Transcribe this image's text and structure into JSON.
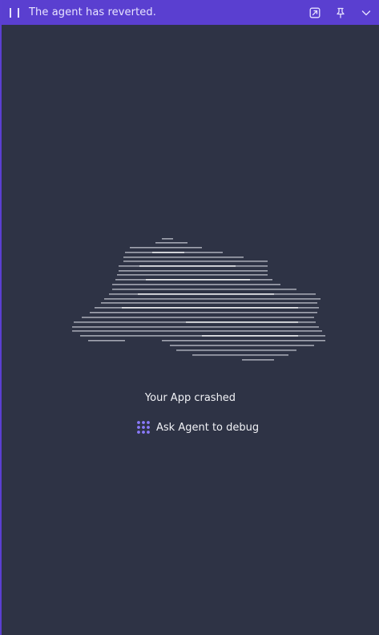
{
  "topbar": {
    "status_text": "The agent has reverted.",
    "icons": [
      "pause-icon",
      "open-external-icon",
      "pin-icon",
      "chevron-down-icon"
    ]
  },
  "crash": {
    "title": "Your App crashed",
    "debug_label": "Ask Agent to debug"
  },
  "colors": {
    "topbar": "#5a3fd0",
    "background": "#2e3345",
    "text": "#f1f2f6",
    "accent_icon": "#8b7bff"
  }
}
